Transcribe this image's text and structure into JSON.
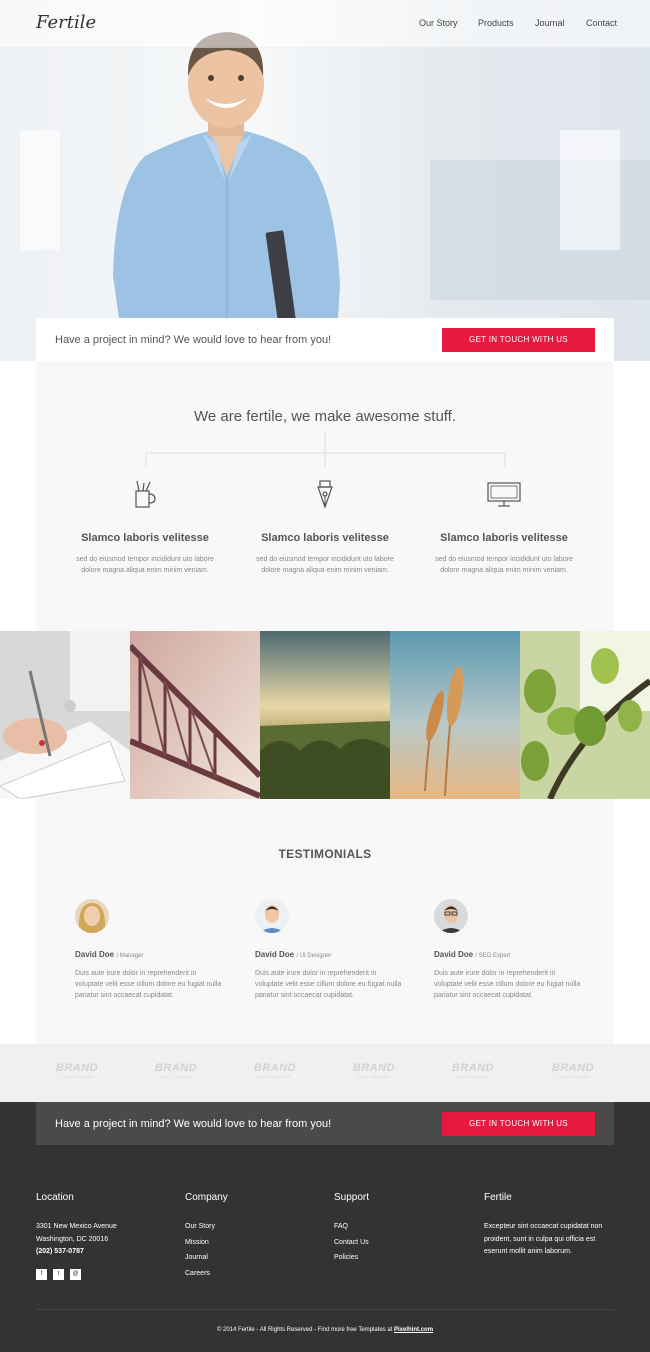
{
  "header": {
    "logo": "Fertile",
    "nav": [
      "Our Story",
      "Products",
      "Journal",
      "Contact"
    ]
  },
  "cta": {
    "text": "Have a project in mind? We would love to hear from you!",
    "button": "GET IN TOUCH WITH US"
  },
  "features": {
    "title": "We are fertile, we make awesome stuff.",
    "items": [
      {
        "icon": "pencil-cup-icon",
        "title": "Slamco laboris velitesse",
        "text": "sed do eiusmod tempor incididunt uto labore dolore magna aliqua enim minim veniam."
      },
      {
        "icon": "pen-nib-icon",
        "title": "Slamco laboris velitesse",
        "text": "sed do eiusmod tempor incididunt uto labore dolore magna aliqua enim minim veniam."
      },
      {
        "icon": "monitor-icon",
        "title": "Slamco laboris velitesse",
        "text": "sed do eiusmod tempor incididunt uto labore dolore magna aliqua enim minim veniam."
      }
    ]
  },
  "gallery": [
    "writing-hand-photo",
    "bridge-photo",
    "field-sunset-photo",
    "wheat-photo",
    "leaves-photo"
  ],
  "testimonials": {
    "title": "TESTIMONIALS",
    "items": [
      {
        "name": "David Doe",
        "role": "/ Manager",
        "text": "Duis aute irure dolor in reprehenderit in voluptate velit esse cillum dolore eu fugiat nulla pariatur sint occaecat cupidatat."
      },
      {
        "name": "David Doe",
        "role": "/ UI Designer",
        "text": "Duis aute irure dolor in reprehenderit in voluptate velit esse cillum dolore eu fugiat nulla pariatur sint occaecat cupidatat."
      },
      {
        "name": "David Doe",
        "role": "/ SEO Expert",
        "text": "Duis aute irure dolor in reprehenderit in voluptate velit esse cillum dolore eu fugiat nulla pariatur sint occaecat cupidatat."
      }
    ]
  },
  "brands": [
    {
      "name": "BRAND",
      "tagline": "your tagline"
    },
    {
      "name": "BRAND",
      "tagline": "your tagline"
    },
    {
      "name": "BRAND",
      "tagline": "your tagline"
    },
    {
      "name": "BRAND",
      "tagline": "your tagline"
    },
    {
      "name": "BRAND",
      "tagline": "your tagline"
    },
    {
      "name": "BRAND",
      "tagline": "your tagline"
    }
  ],
  "footer": {
    "location": {
      "heading": "Location",
      "address1": "3301 New Mexico Avenue",
      "address2": "Washington, DC 20016",
      "phone": "(202) 537-0787",
      "social": [
        "f",
        "t",
        "@"
      ]
    },
    "company": {
      "heading": "Company",
      "links": [
        "Our Story",
        "Mission",
        "Journal",
        "Careers"
      ]
    },
    "support": {
      "heading": "Support",
      "links": [
        "FAQ",
        "Contact Us",
        "Policies"
      ]
    },
    "about": {
      "heading": "Fertile",
      "text": "Excepteur sint occaecat cupidatat non proident, sunt in culpa qui officia est eserunt mollit anim laborum."
    },
    "copyright_prefix": "© 2014 Fertile - All Rights Reserved - Find more free Templates at ",
    "copyright_link": "Pixelhint.com"
  },
  "colors": {
    "accent": "#e8193f",
    "footer_bg": "#333333",
    "section_bg": "#f8f8f8"
  }
}
